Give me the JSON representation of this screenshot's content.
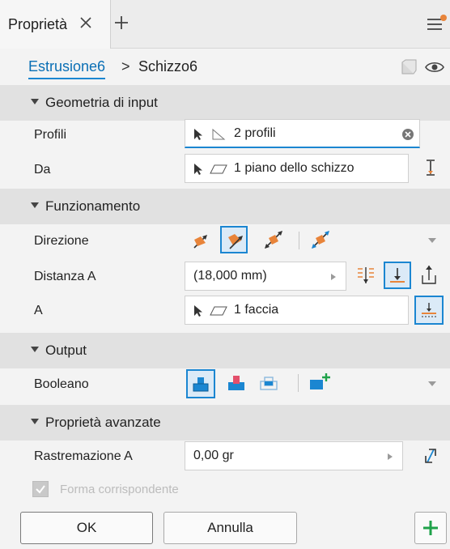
{
  "tab": {
    "title": "Proprietà"
  },
  "breadcrumb": {
    "item1": "Estrusione6",
    "separator": ">",
    "item2": "Schizzo6"
  },
  "sections": {
    "input": "Geometria di input",
    "behavior": "Funzionamento",
    "output": "Output",
    "advanced": "Proprietà avanzate"
  },
  "fields": {
    "profiles_label": "Profili",
    "profiles_value": "2 profili",
    "from_label": "Da",
    "from_value": "1 piano dello schizzo",
    "direction_label": "Direzione",
    "distance_label": "Distanza A",
    "distance_value": "(18,000 mm)",
    "to_label": "A",
    "to_value": "1 faccia",
    "boolean_label": "Booleano",
    "taper_label": "Rastremazione A",
    "taper_value": "0,00 gr",
    "match_shape_label": "Forma corrispondente"
  },
  "buttons": {
    "ok": "OK",
    "cancel": "Annulla"
  },
  "colors": {
    "accent": "#1b86d1",
    "orange": "#e8843a",
    "section_bg": "#e1e1e1"
  },
  "icons": [
    "close-icon",
    "plus-icon",
    "menu-icon",
    "cube-icon",
    "eye-icon",
    "cursor-icon",
    "profile-shape-icon",
    "plane-icon",
    "clear-icon",
    "flip-icon",
    "direction-icon",
    "dropdown-icon",
    "join-icon",
    "cut-icon",
    "intersect-icon",
    "new-solid-icon",
    "taper-flip-icon",
    "add-icon",
    "checkbox-icon"
  ]
}
